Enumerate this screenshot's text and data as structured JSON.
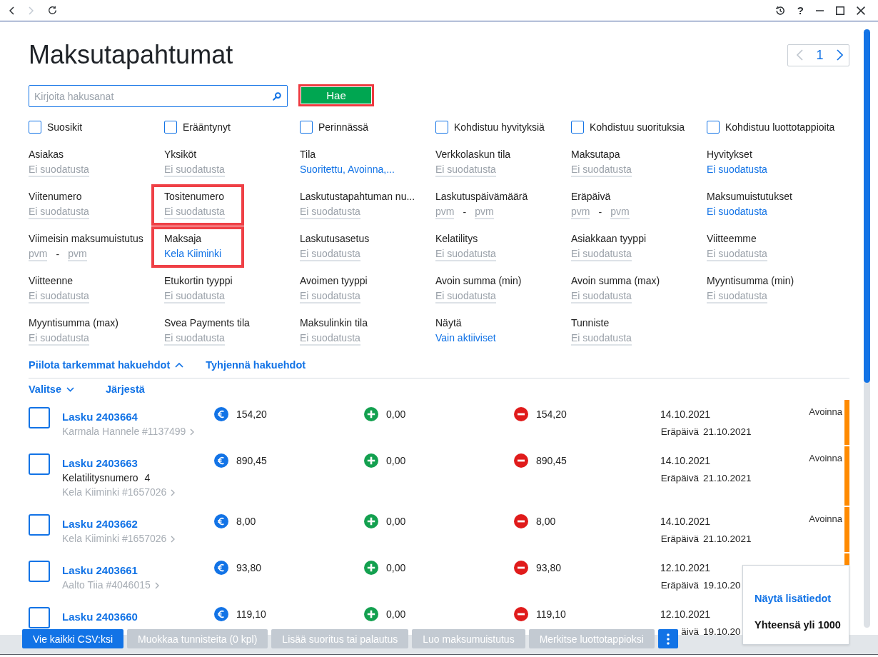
{
  "window_bar": {
    "back": {
      "disabled": false
    },
    "forward": {
      "disabled": true
    },
    "help": "?"
  },
  "page": {
    "title": "Maksutapahtumat"
  },
  "pager": {
    "page": "1",
    "previous_disabled": true,
    "next_disabled": false
  },
  "search": {
    "placeholder": "Kirjoita hakusanat",
    "button": {
      "label": "Hae",
      "highlighted": true
    }
  },
  "quick_filters": [
    {
      "label": "Suosikit",
      "checked": false
    },
    {
      "label": "Erääntynyt",
      "checked": false
    },
    {
      "label": "Perinnässä",
      "checked": false
    },
    {
      "label": "Kohdistuu hyvityksiä",
      "checked": false
    },
    {
      "label": "Kohdistuu suorituksia",
      "checked": false
    },
    {
      "label": "Kohdistuu luottotappioita",
      "checked": false
    }
  ],
  "filters": [
    {
      "kind": "text",
      "label": "Asiakas",
      "value": "Ei suodatusta",
      "active": false,
      "highlighted": false
    },
    {
      "kind": "text",
      "label": "Yksiköt",
      "value": "Ei suodatusta",
      "active": false,
      "highlighted": false
    },
    {
      "kind": "text",
      "label": "Tila",
      "value": "Suoritettu, Avoinna,...",
      "active": true,
      "highlighted": false
    },
    {
      "kind": "text",
      "label": "Verkkolaskun tila",
      "value": "Ei suodatusta",
      "active": false,
      "highlighted": false
    },
    {
      "kind": "text",
      "label": "Maksutapa",
      "value": "Ei suodatusta",
      "active": false,
      "highlighted": false
    },
    {
      "kind": "text",
      "label": "Hyvitykset",
      "value": "Ei suodatusta",
      "active": true,
      "highlighted": false
    },
    {
      "kind": "text",
      "label": "Viitenumero",
      "value": "Ei suodatusta",
      "active": false,
      "highlighted": false
    },
    {
      "kind": "text",
      "label": "Tositenumero",
      "value": "Ei suodatusta",
      "active": false,
      "highlighted": true
    },
    {
      "kind": "text",
      "label": "Laskutustapahtuman nu...",
      "value": "Ei suodatusta",
      "active": false,
      "highlighted": false
    },
    {
      "kind": "date_range",
      "label": "Laskutuspäivämäärä",
      "from": "pvm",
      "separator": "-",
      "to": "pvm",
      "highlighted": false
    },
    {
      "kind": "date_range",
      "label": "Eräpäivä",
      "from": "pvm",
      "separator": "-",
      "to": "pvm",
      "highlighted": false
    },
    {
      "kind": "text",
      "label": "Maksumuistutukset",
      "value": "Ei suodatusta",
      "active": true,
      "highlighted": false
    },
    {
      "kind": "date_range",
      "label": "Viimeisin maksumuistutus",
      "from": "pvm",
      "separator": "-",
      "to": "pvm",
      "highlighted": false
    },
    {
      "kind": "text",
      "label": "Maksaja",
      "value": "Kela Kiiminki",
      "active": true,
      "highlighted": true
    },
    {
      "kind": "text",
      "label": "Laskutusasetus",
      "value": "Ei suodatusta",
      "active": false,
      "highlighted": false
    },
    {
      "kind": "text",
      "label": "Kelatilitys",
      "value": "Ei suodatusta",
      "active": false,
      "highlighted": false
    },
    {
      "kind": "text",
      "label": "Asiakkaan tyyppi",
      "value": "Ei suodatusta",
      "active": false,
      "highlighted": false
    },
    {
      "kind": "text",
      "label": "Viitteemme",
      "value": "Ei suodatusta",
      "active": false,
      "highlighted": false
    },
    {
      "kind": "text",
      "label": "Viitteenne",
      "value": "Ei suodatusta",
      "active": false,
      "highlighted": false
    },
    {
      "kind": "text",
      "label": "Etukortin tyyppi",
      "value": "Ei suodatusta",
      "active": false,
      "highlighted": false
    },
    {
      "kind": "text",
      "label": "Avoimen tyyppi",
      "value": "Ei suodatusta",
      "active": false,
      "highlighted": false
    },
    {
      "kind": "text",
      "label": "Avoin summa (min)",
      "value": "Ei suodatusta",
      "active": false,
      "highlighted": false
    },
    {
      "kind": "text",
      "label": "Avoin summa (max)",
      "value": "Ei suodatusta",
      "active": false,
      "highlighted": false
    },
    {
      "kind": "text",
      "label": "Myyntisumma (min)",
      "value": "Ei suodatusta",
      "active": false,
      "highlighted": false
    },
    {
      "kind": "text",
      "label": "Myyntisumma (max)",
      "value": "Ei suodatusta",
      "active": false,
      "highlighted": false
    },
    {
      "kind": "text",
      "label": "Svea Payments tila",
      "value": "Ei suodatusta",
      "active": false,
      "highlighted": false
    },
    {
      "kind": "text",
      "label": "Maksulinkin tila",
      "value": "Ei suodatusta",
      "active": false,
      "highlighted": false
    },
    {
      "kind": "text",
      "label": "Näytä",
      "value": "Vain aktiiviset",
      "active": true,
      "highlighted": false
    },
    {
      "kind": "text",
      "label": "Tunniste",
      "value": "Ei suodatusta",
      "active": false,
      "highlighted": false
    }
  ],
  "filter_actions": [
    {
      "label": "Piilota tarkemmat hakuehdot",
      "kind": "collapse"
    },
    {
      "label": "Tyhjennä hakuehdot",
      "kind": "clear"
    }
  ],
  "list_actions": [
    {
      "label": "Valitse",
      "kind": "dropdown"
    },
    {
      "label": "Järjestä",
      "kind": "plain"
    }
  ],
  "invoices": [
    {
      "title": "Lasku 2403664",
      "checked": false,
      "customer": "Karmala Hannele #1137499",
      "total": "154,20",
      "paid": "0,00",
      "open": "154,20",
      "date": "14.10.2021",
      "due_label": "Eräpäivä",
      "due_date": "21.10.2021",
      "status": "Avoinna",
      "color": "#ff8a00"
    },
    {
      "title": "Lasku 2403663",
      "checked": false,
      "extra": {
        "label": "Kelatilitysnumero",
        "value": "4"
      },
      "customer": "Kela Kiiminki #1657026",
      "total": "890,45",
      "paid": "0,00",
      "open": "890,45",
      "date": "14.10.2021",
      "due_label": "Eräpäivä",
      "due_date": "21.10.2021",
      "status": "Avoinna",
      "color": "#ff8a00"
    },
    {
      "title": "Lasku 2403662",
      "checked": false,
      "customer": "Kela Kiiminki #1657026",
      "total": "8,00",
      "paid": "0,00",
      "open": "8,00",
      "date": "14.10.2021",
      "due_label": "Eräpäivä",
      "due_date": "21.10.2021",
      "status": "Avoinna",
      "color": "#ff8a00"
    },
    {
      "title": "Lasku 2403661",
      "checked": false,
      "customer": "Aalto Tiia #4046015",
      "total": "93,80",
      "paid": "0,00",
      "open": "93,80",
      "date": "12.10.2021",
      "due_label": "Eräpäivä",
      "due_date": "19.10.20",
      "color": "#ff8a00"
    },
    {
      "title": "Lasku 2403660",
      "checked": false,
      "total": "119,10",
      "paid": "0,00",
      "open": "119,10",
      "date": "12.10.2021",
      "due_label": "äivä",
      "due_date": "19.10.20"
    }
  ],
  "bottom_actions": [
    {
      "label": "Vie kaikki CSV:ksi",
      "disabled": false
    },
    {
      "label": "Muokkaa tunnisteita (0 kpl)",
      "disabled": true
    },
    {
      "label": "Lisää suoritus tai palautus",
      "disabled": true
    },
    {
      "label": "Luo maksumuistutus",
      "disabled": true
    },
    {
      "label": "Merkitse luottotappioksi",
      "disabled": true
    }
  ],
  "popup": {
    "items": [
      {
        "label": "Näytä lisätiedot",
        "kind": "link"
      },
      {
        "label": "Yhteensä yli 1000",
        "kind": "total"
      }
    ]
  }
}
